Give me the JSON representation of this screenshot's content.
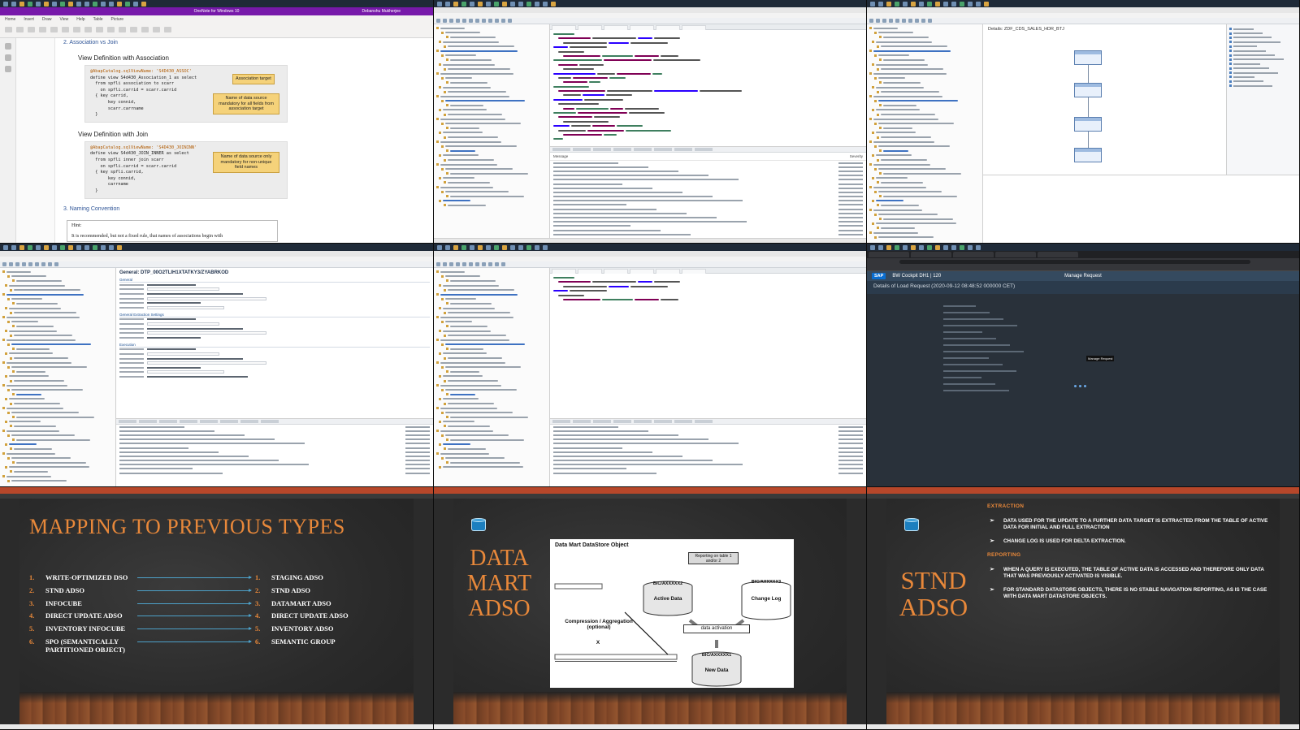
{
  "onenote": {
    "window_title": "OneNote for Windows 10",
    "user": "Debanshu Mukherjee",
    "ribbon_tabs": [
      "Home",
      "Insert",
      "Draw",
      "View",
      "Help",
      "Table",
      "Picture"
    ],
    "section_heading": "2. Association vs Join",
    "view_assoc_heading": "View Definition with Association",
    "assoc_code": [
      "@AbapCatalog.sqlViewName: 'S4D430_ASSOC'",
      "define view S4d430_Association_1 as select",
      "  from spfli association to scarr",
      "    on spfli.carrid = scarr.carrid",
      "  { key carrid,",
      "       key connid,",
      "       scarr.carrname",
      "  }"
    ],
    "callout_target": "Association target",
    "callout_mandatory": "Name of data source mandatory for all fields from association target",
    "view_join_heading": "View Definition with Join",
    "join_code": [
      "@AbapCatalog.sqlViewName: 'S4D430_JOININN'",
      "define view S4d430_JOIN_INNER as select",
      "  from spfli inner join scarr",
      "    on spfli.carrid = scarr.carrid",
      "  { key spfli.carrid,",
      "       key connid,",
      "       carrname",
      "  }"
    ],
    "callout_join": "Name of data source only mandatory for non-unique field names",
    "naming_heading": "3. Naming Convention",
    "hint_title": "Hint:",
    "hint_body": "It is recommended, but not a fixed rule, that names of associations begin with"
  },
  "eclipse_cds": {
    "console_cols": [
      "Message",
      "Severity"
    ]
  },
  "eclipse_graph": {
    "canvas_title": "Details: ZDF_CDS_SALES_HDR_BTJ"
  },
  "eclipse_dtp": {
    "form_title": "General: DTP_00O2TLIH1XTATKY3/ZYABRKOD",
    "sections": [
      "General",
      "General Extraction Settings",
      "Execution"
    ]
  },
  "sap_web": {
    "logo": "SAP",
    "shell_title": "BW Cockpit DH1 | 120",
    "app_title": "Manage Request",
    "page_heading": "Details of Load Request (2020-09-12 08:48:52 000000 CET)",
    "tooltip": "Manage Request"
  },
  "slide_mapping": {
    "title": "MAPPING TO PREVIOUS TYPES",
    "left": [
      {
        "num": "1.",
        "label": "WRITE-OPTIMIZED DSO"
      },
      {
        "num": "2.",
        "label": "STND ADSO"
      },
      {
        "num": "3.",
        "label": "INFOCUBE"
      },
      {
        "num": "4.",
        "label": "DIRECT UPDATE ADSO"
      },
      {
        "num": "5.",
        "label": "INVENTORY INFOCUBE"
      },
      {
        "num": "6.",
        "label": "SPO (SEMANTICALLY PARTITIONED OBJECT)"
      }
    ],
    "right": [
      {
        "num": "1.",
        "label": "STAGING ADSO"
      },
      {
        "num": "2.",
        "label": "STND ADSO"
      },
      {
        "num": "3.",
        "label": "DATAMART ADSO"
      },
      {
        "num": "4.",
        "label": "DIRECT UPDATE ADSO"
      },
      {
        "num": "5.",
        "label": "INVENTORY ADSO"
      },
      {
        "num": "6.",
        "label": "SEMANTIC GROUP"
      }
    ]
  },
  "slide_datamart": {
    "title_lines": [
      "DATA",
      "MART",
      "ADSO"
    ],
    "diagram_title": "Data Mart DataStore Object",
    "reporting_label": "Reporting on table 1 and/or 2",
    "active_data_id": "BIC/AXXXXX2",
    "active_data": "Active Data",
    "change_log_id": "BIC/AXXXXX3",
    "change_log": "Change Log",
    "compression": "Compression / Aggregation (optional)",
    "activation": "data activation",
    "new_data_id": "BIC/AXXXXX1",
    "new_data": "New Data",
    "x_mark": "X"
  },
  "slide_stnd": {
    "title_lines": [
      "STND",
      "ADSO"
    ],
    "extraction_heading": "EXTRACTION",
    "extraction_items": [
      "DATA USED FOR THE UPDATE TO A FURTHER DATA TARGET IS EXTRACTED FROM THE TABLE OF ACTIVE DATA FOR INITIAL AND FULL EXTRACTION",
      "CHANGE LOG IS USED FOR DELTA EXTRACTION."
    ],
    "reporting_heading": "REPORTING",
    "reporting_items": [
      "WHEN A QUERY IS EXECUTED, THE TABLE OF ACTIVE DATA IS ACCESSED AND THEREFORE ONLY DATA THAT WAS PREVIOUSLY ACTIVATED IS VISIBLE.",
      "FOR STANDARD DATASTORE OBJECTS, THERE IS NO STABLE NAVIGATION REPORTING, AS IS THE CASE WITH DATA MART DATASTORE OBJECTS."
    ],
    "bullet_glyph": "➢"
  },
  "colors": {
    "slide_accent": "#e8883a",
    "onenote_purple": "#7719aa",
    "sap_shell": "#354a5f",
    "arrow_blue": "#4da1c9"
  }
}
